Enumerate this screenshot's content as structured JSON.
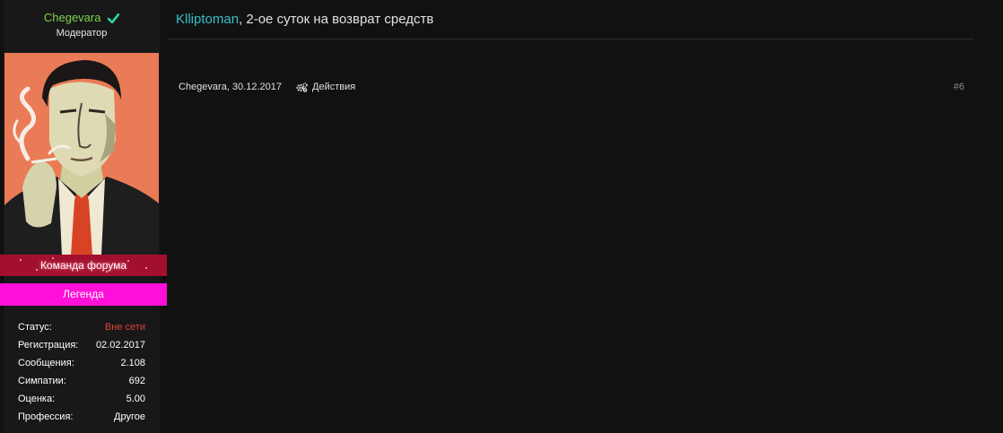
{
  "user": {
    "name": "Chegevara",
    "title": "Модератор",
    "banners": {
      "team": "Команда форума",
      "legend": "Легенда"
    },
    "stats": [
      {
        "label": "Статус:",
        "value": "Вне сети",
        "status": "offline"
      },
      {
        "label": "Регистрация:",
        "value": "02.02.2017"
      },
      {
        "label": "Сообщения:",
        "value": "2.108"
      },
      {
        "label": "Симпатии:",
        "value": "692"
      },
      {
        "label": "Оценка:",
        "value": "5.00"
      },
      {
        "label": "Профессия:",
        "value": "Другое"
      }
    ]
  },
  "post": {
    "title_user": "Klliptoman",
    "title_rest": ", 2-ое суток на возврат средств",
    "meta": "Chegevara, 30.12.2017",
    "actions_label": "Действия",
    "number": "#6"
  },
  "colors": {
    "username": "#7bd44a",
    "title_user": "#37c0c8",
    "offline": "#e0413b",
    "team_banner": "#a2102d",
    "legend_banner": "#ff10d8"
  },
  "icons": {
    "verified": "check-icon",
    "actions": "gears-icon"
  }
}
